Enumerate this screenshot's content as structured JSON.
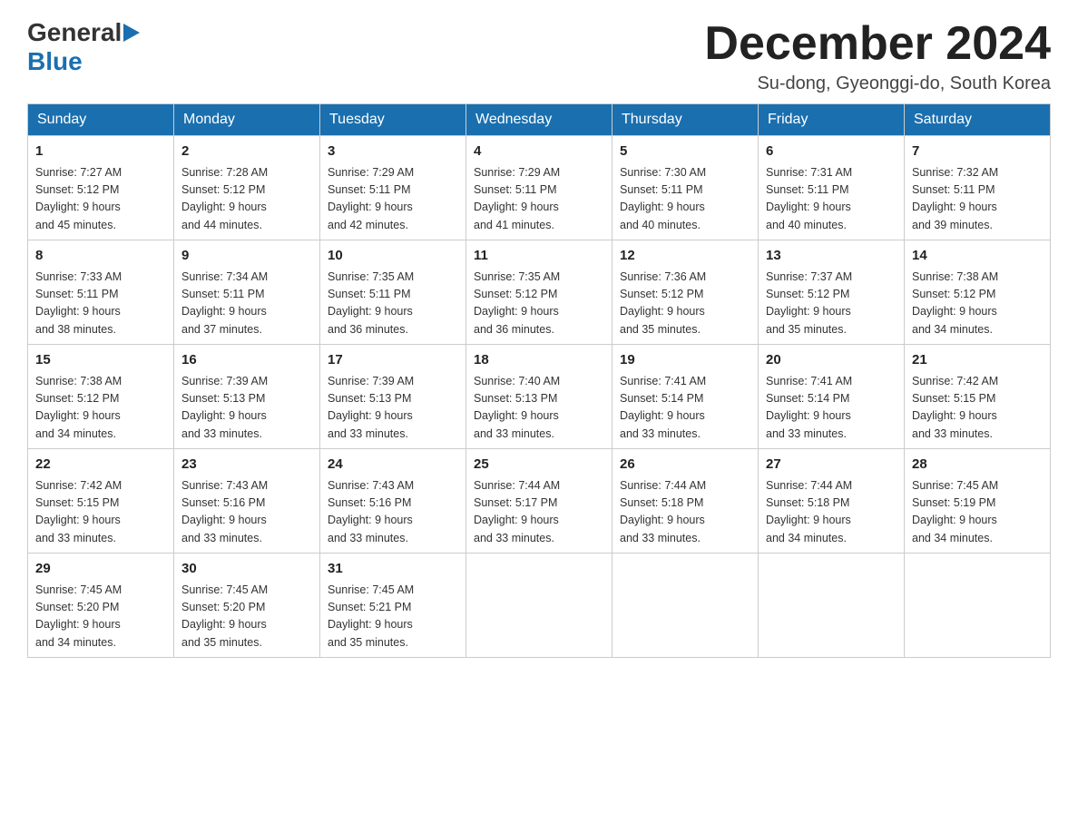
{
  "header": {
    "logo_general": "General",
    "logo_blue": "Blue",
    "month_title": "December 2024",
    "subtitle": "Su-dong, Gyeonggi-do, South Korea"
  },
  "weekdays": [
    "Sunday",
    "Monday",
    "Tuesday",
    "Wednesday",
    "Thursday",
    "Friday",
    "Saturday"
  ],
  "weeks": [
    [
      {
        "day": "1",
        "sunrise": "7:27 AM",
        "sunset": "5:12 PM",
        "daylight": "9 hours and 45 minutes."
      },
      {
        "day": "2",
        "sunrise": "7:28 AM",
        "sunset": "5:12 PM",
        "daylight": "9 hours and 44 minutes."
      },
      {
        "day": "3",
        "sunrise": "7:29 AM",
        "sunset": "5:11 PM",
        "daylight": "9 hours and 42 minutes."
      },
      {
        "day": "4",
        "sunrise": "7:29 AM",
        "sunset": "5:11 PM",
        "daylight": "9 hours and 41 minutes."
      },
      {
        "day": "5",
        "sunrise": "7:30 AM",
        "sunset": "5:11 PM",
        "daylight": "9 hours and 40 minutes."
      },
      {
        "day": "6",
        "sunrise": "7:31 AM",
        "sunset": "5:11 PM",
        "daylight": "9 hours and 40 minutes."
      },
      {
        "day": "7",
        "sunrise": "7:32 AM",
        "sunset": "5:11 PM",
        "daylight": "9 hours and 39 minutes."
      }
    ],
    [
      {
        "day": "8",
        "sunrise": "7:33 AM",
        "sunset": "5:11 PM",
        "daylight": "9 hours and 38 minutes."
      },
      {
        "day": "9",
        "sunrise": "7:34 AM",
        "sunset": "5:11 PM",
        "daylight": "9 hours and 37 minutes."
      },
      {
        "day": "10",
        "sunrise": "7:35 AM",
        "sunset": "5:11 PM",
        "daylight": "9 hours and 36 minutes."
      },
      {
        "day": "11",
        "sunrise": "7:35 AM",
        "sunset": "5:12 PM",
        "daylight": "9 hours and 36 minutes."
      },
      {
        "day": "12",
        "sunrise": "7:36 AM",
        "sunset": "5:12 PM",
        "daylight": "9 hours and 35 minutes."
      },
      {
        "day": "13",
        "sunrise": "7:37 AM",
        "sunset": "5:12 PM",
        "daylight": "9 hours and 35 minutes."
      },
      {
        "day": "14",
        "sunrise": "7:38 AM",
        "sunset": "5:12 PM",
        "daylight": "9 hours and 34 minutes."
      }
    ],
    [
      {
        "day": "15",
        "sunrise": "7:38 AM",
        "sunset": "5:12 PM",
        "daylight": "9 hours and 34 minutes."
      },
      {
        "day": "16",
        "sunrise": "7:39 AM",
        "sunset": "5:13 PM",
        "daylight": "9 hours and 33 minutes."
      },
      {
        "day": "17",
        "sunrise": "7:39 AM",
        "sunset": "5:13 PM",
        "daylight": "9 hours and 33 minutes."
      },
      {
        "day": "18",
        "sunrise": "7:40 AM",
        "sunset": "5:13 PM",
        "daylight": "9 hours and 33 minutes."
      },
      {
        "day": "19",
        "sunrise": "7:41 AM",
        "sunset": "5:14 PM",
        "daylight": "9 hours and 33 minutes."
      },
      {
        "day": "20",
        "sunrise": "7:41 AM",
        "sunset": "5:14 PM",
        "daylight": "9 hours and 33 minutes."
      },
      {
        "day": "21",
        "sunrise": "7:42 AM",
        "sunset": "5:15 PM",
        "daylight": "9 hours and 33 minutes."
      }
    ],
    [
      {
        "day": "22",
        "sunrise": "7:42 AM",
        "sunset": "5:15 PM",
        "daylight": "9 hours and 33 minutes."
      },
      {
        "day": "23",
        "sunrise": "7:43 AM",
        "sunset": "5:16 PM",
        "daylight": "9 hours and 33 minutes."
      },
      {
        "day": "24",
        "sunrise": "7:43 AM",
        "sunset": "5:16 PM",
        "daylight": "9 hours and 33 minutes."
      },
      {
        "day": "25",
        "sunrise": "7:44 AM",
        "sunset": "5:17 PM",
        "daylight": "9 hours and 33 minutes."
      },
      {
        "day": "26",
        "sunrise": "7:44 AM",
        "sunset": "5:18 PM",
        "daylight": "9 hours and 33 minutes."
      },
      {
        "day": "27",
        "sunrise": "7:44 AM",
        "sunset": "5:18 PM",
        "daylight": "9 hours and 34 minutes."
      },
      {
        "day": "28",
        "sunrise": "7:45 AM",
        "sunset": "5:19 PM",
        "daylight": "9 hours and 34 minutes."
      }
    ],
    [
      {
        "day": "29",
        "sunrise": "7:45 AM",
        "sunset": "5:20 PM",
        "daylight": "9 hours and 34 minutes."
      },
      {
        "day": "30",
        "sunrise": "7:45 AM",
        "sunset": "5:20 PM",
        "daylight": "9 hours and 35 minutes."
      },
      {
        "day": "31",
        "sunrise": "7:45 AM",
        "sunset": "5:21 PM",
        "daylight": "9 hours and 35 minutes."
      },
      null,
      null,
      null,
      null
    ]
  ],
  "labels": {
    "sunrise_prefix": "Sunrise: ",
    "sunset_prefix": "Sunset: ",
    "daylight_prefix": "Daylight: "
  }
}
